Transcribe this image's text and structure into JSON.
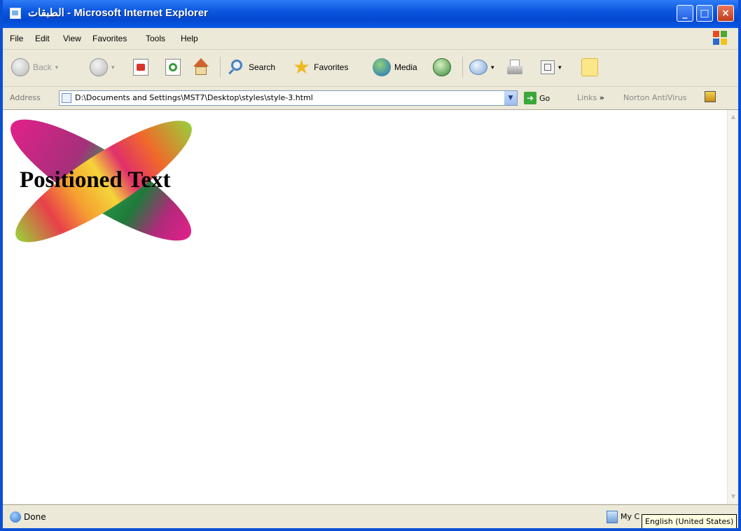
{
  "window": {
    "title": "الطبقات - Microsoft Internet Explorer",
    "controls": {
      "minimize": "_",
      "maximize": "□",
      "close": "×"
    }
  },
  "menu": [
    "File",
    "Edit",
    "View",
    "Favorites",
    "Tools",
    "Help"
  ],
  "toolbar": {
    "back": "Back",
    "search": "Search",
    "favorites": "Favorites",
    "media": "Media"
  },
  "address": {
    "label": "Address",
    "value": "D:\\Documents and Settings\\MST7\\Desktop\\styles\\style-3.html",
    "go": "Go",
    "links": "Links",
    "norton": "Norton AntiVirus"
  },
  "content": {
    "positioned_text": "Positioned Text"
  },
  "status": {
    "text": "Done",
    "zone": "My C",
    "tooltip": "English (United States)"
  },
  "colors": {
    "titlebar": "#0a57e0",
    "chrome": "#ece9d8",
    "shape_magenta": "#e0218a",
    "shape_green": "#9ccc3a",
    "shape_orange": "#f5a030"
  }
}
